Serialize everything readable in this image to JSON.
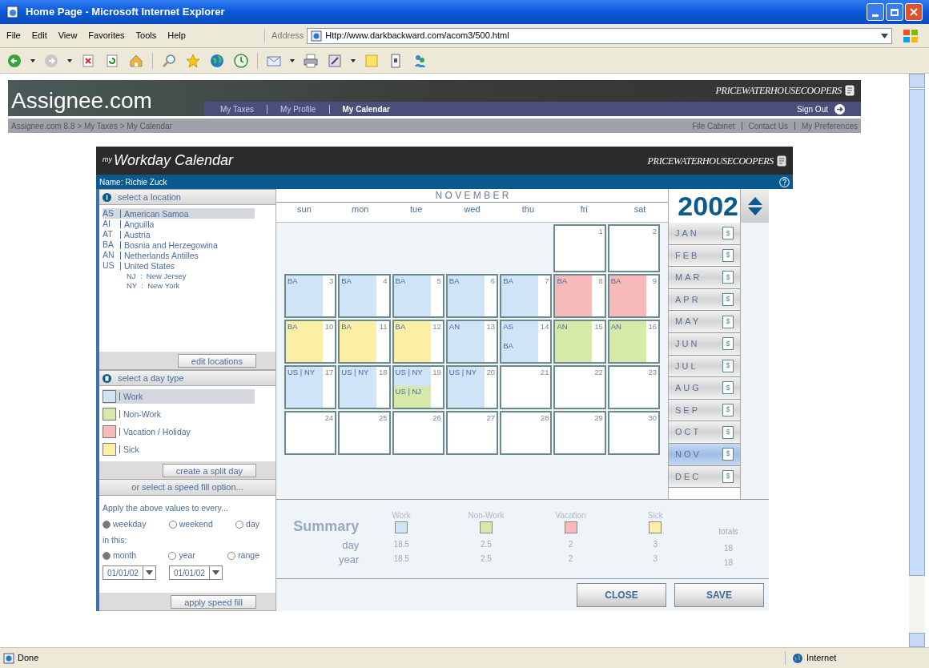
{
  "window": {
    "title": "Home Page - Microsoft Internet Explorer"
  },
  "menu": [
    "File",
    "Edit",
    "View",
    "Favorites",
    "Tools",
    "Help"
  ],
  "address": {
    "label": "Address",
    "url": "Http://www.darkbackward.com/acom3/500.html"
  },
  "site": {
    "logo": "Assignee.com",
    "brand": "PRICEWATERHOUSECOOPERS",
    "nav": [
      {
        "label": "My Taxes",
        "selected": false
      },
      {
        "label": "My Profile",
        "selected": false
      },
      {
        "label": "My Calendar",
        "selected": true
      }
    ],
    "sign_out": "Sign Out",
    "breadcrumb": "Assignee.com 8.8 > My Taxes > My Calendar",
    "links": [
      "File Cabinet",
      "Contact Us",
      "My Preferences"
    ]
  },
  "app": {
    "title_prefix": "my",
    "title": "Workday Calendar",
    "brand": "PRICEWATERHOUSECOOPERS",
    "name": "Name: Richie Zuck"
  },
  "locations": {
    "heading": "select a location",
    "items": [
      {
        "code": "AS",
        "name": "American Samoa",
        "selected": true
      },
      {
        "code": "AI",
        "name": "Anguilla",
        "selected": false
      },
      {
        "code": "AT",
        "name": "Austria",
        "selected": false
      },
      {
        "code": "BA",
        "name": "Bosnia and Herzegowina",
        "selected": false
      },
      {
        "code": "AN",
        "name": "Netherlands Antilles",
        "selected": false
      },
      {
        "code": "US",
        "name": "United States",
        "selected": false,
        "children": [
          {
            "label": "NJ  :  New Jersey"
          },
          {
            "label": "NY  :  New York"
          }
        ]
      }
    ],
    "button": "edit locations"
  },
  "day_types": {
    "heading": "select a day type",
    "items": [
      {
        "label": "Work",
        "color": "#cfe4f7",
        "selected": true
      },
      {
        "label": "Non-Work",
        "color": "#d6e9a8",
        "selected": false
      },
      {
        "label": "Vacation / Holiday",
        "color": "#f7b9b9",
        "selected": false
      },
      {
        "label": "Sick",
        "color": "#fbeea5",
        "selected": false
      }
    ],
    "button": "create a split day"
  },
  "speed_fill": {
    "heading": "or select a speed fill option...",
    "intro": "Apply the above values to every...",
    "groups": [
      {
        "options": [
          {
            "label": "weekday",
            "selected": true
          },
          {
            "label": "weekend",
            "selected": false
          },
          {
            "label": "day",
            "selected": false
          }
        ]
      },
      {
        "label": "in this:",
        "options": [
          {
            "label": "month",
            "selected": true
          },
          {
            "label": "year",
            "selected": false
          },
          {
            "label": "range",
            "selected": false
          }
        ]
      }
    ],
    "dates": [
      "01/01/02",
      "01/01/02"
    ],
    "button": "apply speed fill"
  },
  "calendar": {
    "month": "N O V E M B E R",
    "weekdays": [
      "sun",
      "mon",
      "tue",
      "wed",
      "thu",
      "fri",
      "sat"
    ],
    "days": [
      {
        "kind": "empty"
      },
      {
        "kind": "empty"
      },
      {
        "kind": "empty"
      },
      {
        "kind": "empty"
      },
      {
        "kind": "empty"
      },
      {
        "kind": "day",
        "day": "1"
      },
      {
        "kind": "day",
        "day": "2"
      },
      {
        "kind": "day",
        "day": "3",
        "entries": [
          {
            "label": "BA",
            "color": "#cfe4f7"
          }
        ]
      },
      {
        "kind": "day",
        "day": "4",
        "entries": [
          {
            "label": "BA",
            "color": "#cfe4f7"
          }
        ]
      },
      {
        "kind": "day",
        "day": "5",
        "entries": [
          {
            "label": "BA",
            "color": "#cfe4f7"
          }
        ]
      },
      {
        "kind": "day",
        "day": "6",
        "entries": [
          {
            "label": "BA",
            "color": "#cfe4f7"
          }
        ]
      },
      {
        "kind": "day",
        "day": "7",
        "entries": [
          {
            "label": "BA",
            "color": "#cfe4f7"
          }
        ]
      },
      {
        "kind": "day",
        "day": "8",
        "entries": [
          {
            "label": "BA",
            "color": "#f7b9b9"
          }
        ]
      },
      {
        "kind": "day",
        "day": "9",
        "entries": [
          {
            "label": "BA",
            "color": "#f7b9b9"
          }
        ]
      },
      {
        "kind": "day",
        "day": "10",
        "entries": [
          {
            "label": "BA",
            "color": "#fbeea5"
          }
        ]
      },
      {
        "kind": "day",
        "day": "11",
        "entries": [
          {
            "label": "BA",
            "color": "#fbeea5"
          }
        ]
      },
      {
        "kind": "day",
        "day": "12",
        "entries": [
          {
            "label": "BA",
            "color": "#fbeea5"
          }
        ]
      },
      {
        "kind": "day",
        "day": "13",
        "entries": [
          {
            "label": "AN",
            "color": "#cfe4f7"
          }
        ]
      },
      {
        "kind": "day",
        "day": "14",
        "entries": [
          {
            "label": "AS",
            "color": "#cfe4f7"
          },
          {
            "label": "BA",
            "color": "#cfe4f7"
          }
        ]
      },
      {
        "kind": "day",
        "day": "15",
        "entries": [
          {
            "label": "AN",
            "color": "#d6e9a8"
          }
        ]
      },
      {
        "kind": "day",
        "day": "16",
        "entries": [
          {
            "label": "AN",
            "color": "#d6e9a8"
          }
        ]
      },
      {
        "kind": "day",
        "day": "17",
        "entries": [
          {
            "label": "US | NY",
            "color": "#cfe4f7"
          }
        ]
      },
      {
        "kind": "day",
        "day": "18",
        "entries": [
          {
            "label": "US | NY",
            "color": "#cfe4f7"
          }
        ]
      },
      {
        "kind": "day",
        "day": "19",
        "entries": [
          {
            "label": "US | NY",
            "color": "#cfe4f7"
          },
          {
            "label": "US | NJ",
            "color": "#d6e9a8"
          }
        ]
      },
      {
        "kind": "day",
        "day": "20",
        "entries": [
          {
            "label": "US | NY",
            "color": "#cfe4f7"
          }
        ]
      },
      {
        "kind": "day",
        "day": "21"
      },
      {
        "kind": "day",
        "day": "22"
      },
      {
        "kind": "day",
        "day": "23"
      },
      {
        "kind": "day",
        "day": "24"
      },
      {
        "kind": "day",
        "day": "25"
      },
      {
        "kind": "day",
        "day": "26"
      },
      {
        "kind": "day",
        "day": "27"
      },
      {
        "kind": "day",
        "day": "28"
      },
      {
        "kind": "day",
        "day": "29"
      },
      {
        "kind": "day",
        "day": "30"
      }
    ]
  },
  "year": "2002",
  "months": [
    {
      "label": "JAN",
      "icon": "$",
      "selected": false
    },
    {
      "label": "FEB",
      "icon": "$",
      "selected": false
    },
    {
      "label": "MAR",
      "icon": "$",
      "selected": false
    },
    {
      "label": "APR",
      "icon": "$",
      "selected": false
    },
    {
      "label": "MAY",
      "icon": "$",
      "selected": false
    },
    {
      "label": "JUN",
      "icon": "$",
      "selected": false
    },
    {
      "label": "JUL",
      "icon": "$",
      "selected": false
    },
    {
      "label": "AUG",
      "icon": "$",
      "selected": false
    },
    {
      "label": "SEP",
      "icon": "$",
      "selected": false
    },
    {
      "label": "OCT",
      "icon": "$",
      "selected": false
    },
    {
      "label": "NOV",
      "icon": "$",
      "selected": true
    },
    {
      "label": "DEC",
      "icon": "$",
      "selected": false
    }
  ],
  "summary": {
    "title": "Summary",
    "row_labels": [
      "day",
      "year"
    ],
    "columns": [
      {
        "label": "Work",
        "color": "#cfe4f7",
        "day": "18.5",
        "year": "18.5"
      },
      {
        "label": "Non-Work",
        "color": "#d6e9a8",
        "day": "2.5",
        "year": "2.5"
      },
      {
        "label": "Vacation",
        "color": "#f7b9b9",
        "day": "2",
        "year": "2"
      },
      {
        "label": "Sick",
        "color": "#fbeea5",
        "day": "3",
        "year": "3"
      }
    ],
    "totals": {
      "label": "totals",
      "day": "18",
      "year": "18"
    }
  },
  "buttons": [
    "CLOSE",
    "SAVE"
  ],
  "status_bar": {
    "text": "Done",
    "zone": "Internet"
  }
}
